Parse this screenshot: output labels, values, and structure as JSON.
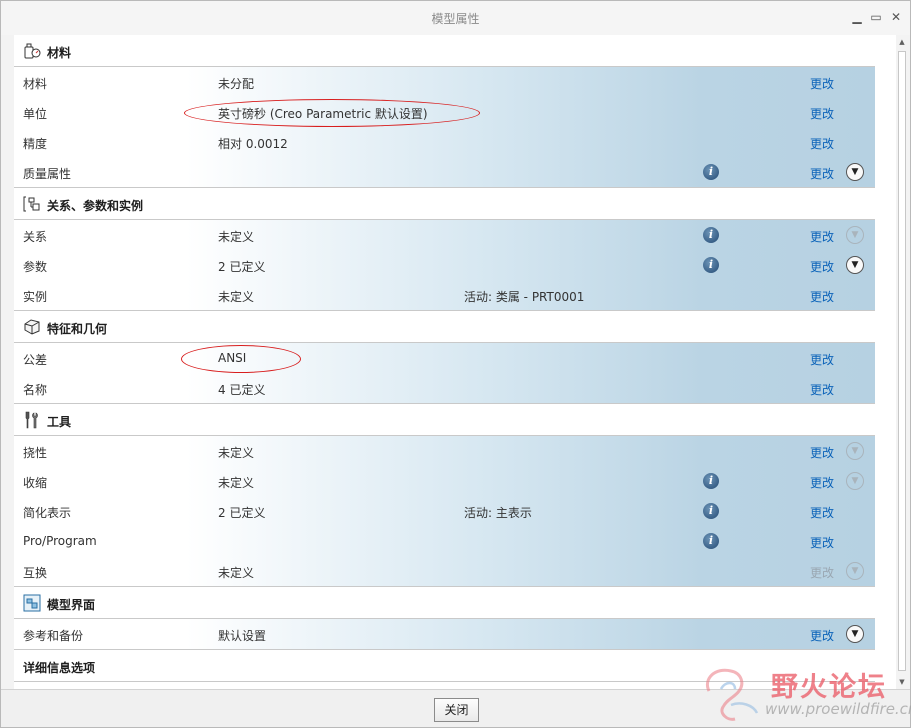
{
  "window": {
    "title": "模型属性"
  },
  "sections": [
    {
      "title": "材料",
      "icon": "material-icon",
      "rows": [
        {
          "label": "材料",
          "value": "未分配",
          "extra": "",
          "info": false,
          "change": "更改",
          "change_disabled": false,
          "expand": "none"
        },
        {
          "label": "单位",
          "value": "英寸磅秒 (Creo Parametric 默认设置)",
          "extra": "",
          "info": false,
          "change": "更改",
          "change_disabled": false,
          "expand": "none"
        },
        {
          "label": "精度",
          "value": "相对 0.0012",
          "extra": "",
          "info": false,
          "change": "更改",
          "change_disabled": false,
          "expand": "none"
        },
        {
          "label": "质量属性",
          "value": "",
          "extra": "",
          "info": true,
          "change": "更改",
          "change_disabled": false,
          "expand": "active"
        }
      ]
    },
    {
      "title": "关系、参数和实例",
      "icon": "relations-icon",
      "rows": [
        {
          "label": "关系",
          "value": "未定义",
          "extra": "",
          "info": true,
          "change": "更改",
          "change_disabled": false,
          "expand": "faded"
        },
        {
          "label": "参数",
          "value": "2 已定义",
          "extra": "",
          "info": true,
          "change": "更改",
          "change_disabled": false,
          "expand": "active"
        },
        {
          "label": "实例",
          "value": "未定义",
          "extra": "活动: 类属 - PRT0001",
          "info": false,
          "change": "更改",
          "change_disabled": false,
          "expand": "none"
        }
      ]
    },
    {
      "title": "特征和几何",
      "icon": "features-icon",
      "rows": [
        {
          "label": "公差",
          "value": "ANSI",
          "extra": "",
          "info": false,
          "change": "更改",
          "change_disabled": false,
          "expand": "none"
        },
        {
          "label": "名称",
          "value": "4 已定义",
          "extra": "",
          "info": false,
          "change": "更改",
          "change_disabled": false,
          "expand": "none"
        }
      ]
    },
    {
      "title": "工具",
      "icon": "tools-icon",
      "rows": [
        {
          "label": "挠性",
          "value": "未定义",
          "extra": "",
          "info": false,
          "change": "更改",
          "change_disabled": false,
          "expand": "faded"
        },
        {
          "label": "收缩",
          "value": "未定义",
          "extra": "",
          "info": true,
          "change": "更改",
          "change_disabled": false,
          "expand": "faded"
        },
        {
          "label": "简化表示",
          "value": "2 已定义",
          "extra": "活动: 主表示",
          "info": true,
          "change": "更改",
          "change_disabled": false,
          "expand": "none"
        },
        {
          "label": "Pro/Program",
          "value": "",
          "extra": "",
          "info": true,
          "change": "更改",
          "change_disabled": false,
          "expand": "none"
        },
        {
          "label": "互换",
          "value": "未定义",
          "extra": "",
          "info": false,
          "change": "更改",
          "change_disabled": true,
          "expand": "faded"
        }
      ]
    },
    {
      "title": "模型界面",
      "icon": "model-interface-icon",
      "rows": [
        {
          "label": "参考和备份",
          "value": "默认设置",
          "extra": "",
          "info": false,
          "change": "更改",
          "change_disabled": false,
          "expand": "active"
        }
      ]
    },
    {
      "title": "详细信息选项",
      "icon": "",
      "rows": []
    }
  ],
  "footer": {
    "close_label": "关闭"
  },
  "watermark": {
    "text": "野火论坛",
    "url": "www.proewildfire.cn"
  },
  "colors": {
    "link": "#0b63b9",
    "annotation": "#d81e1e",
    "row_gradient_end": "#b6d1e2"
  }
}
